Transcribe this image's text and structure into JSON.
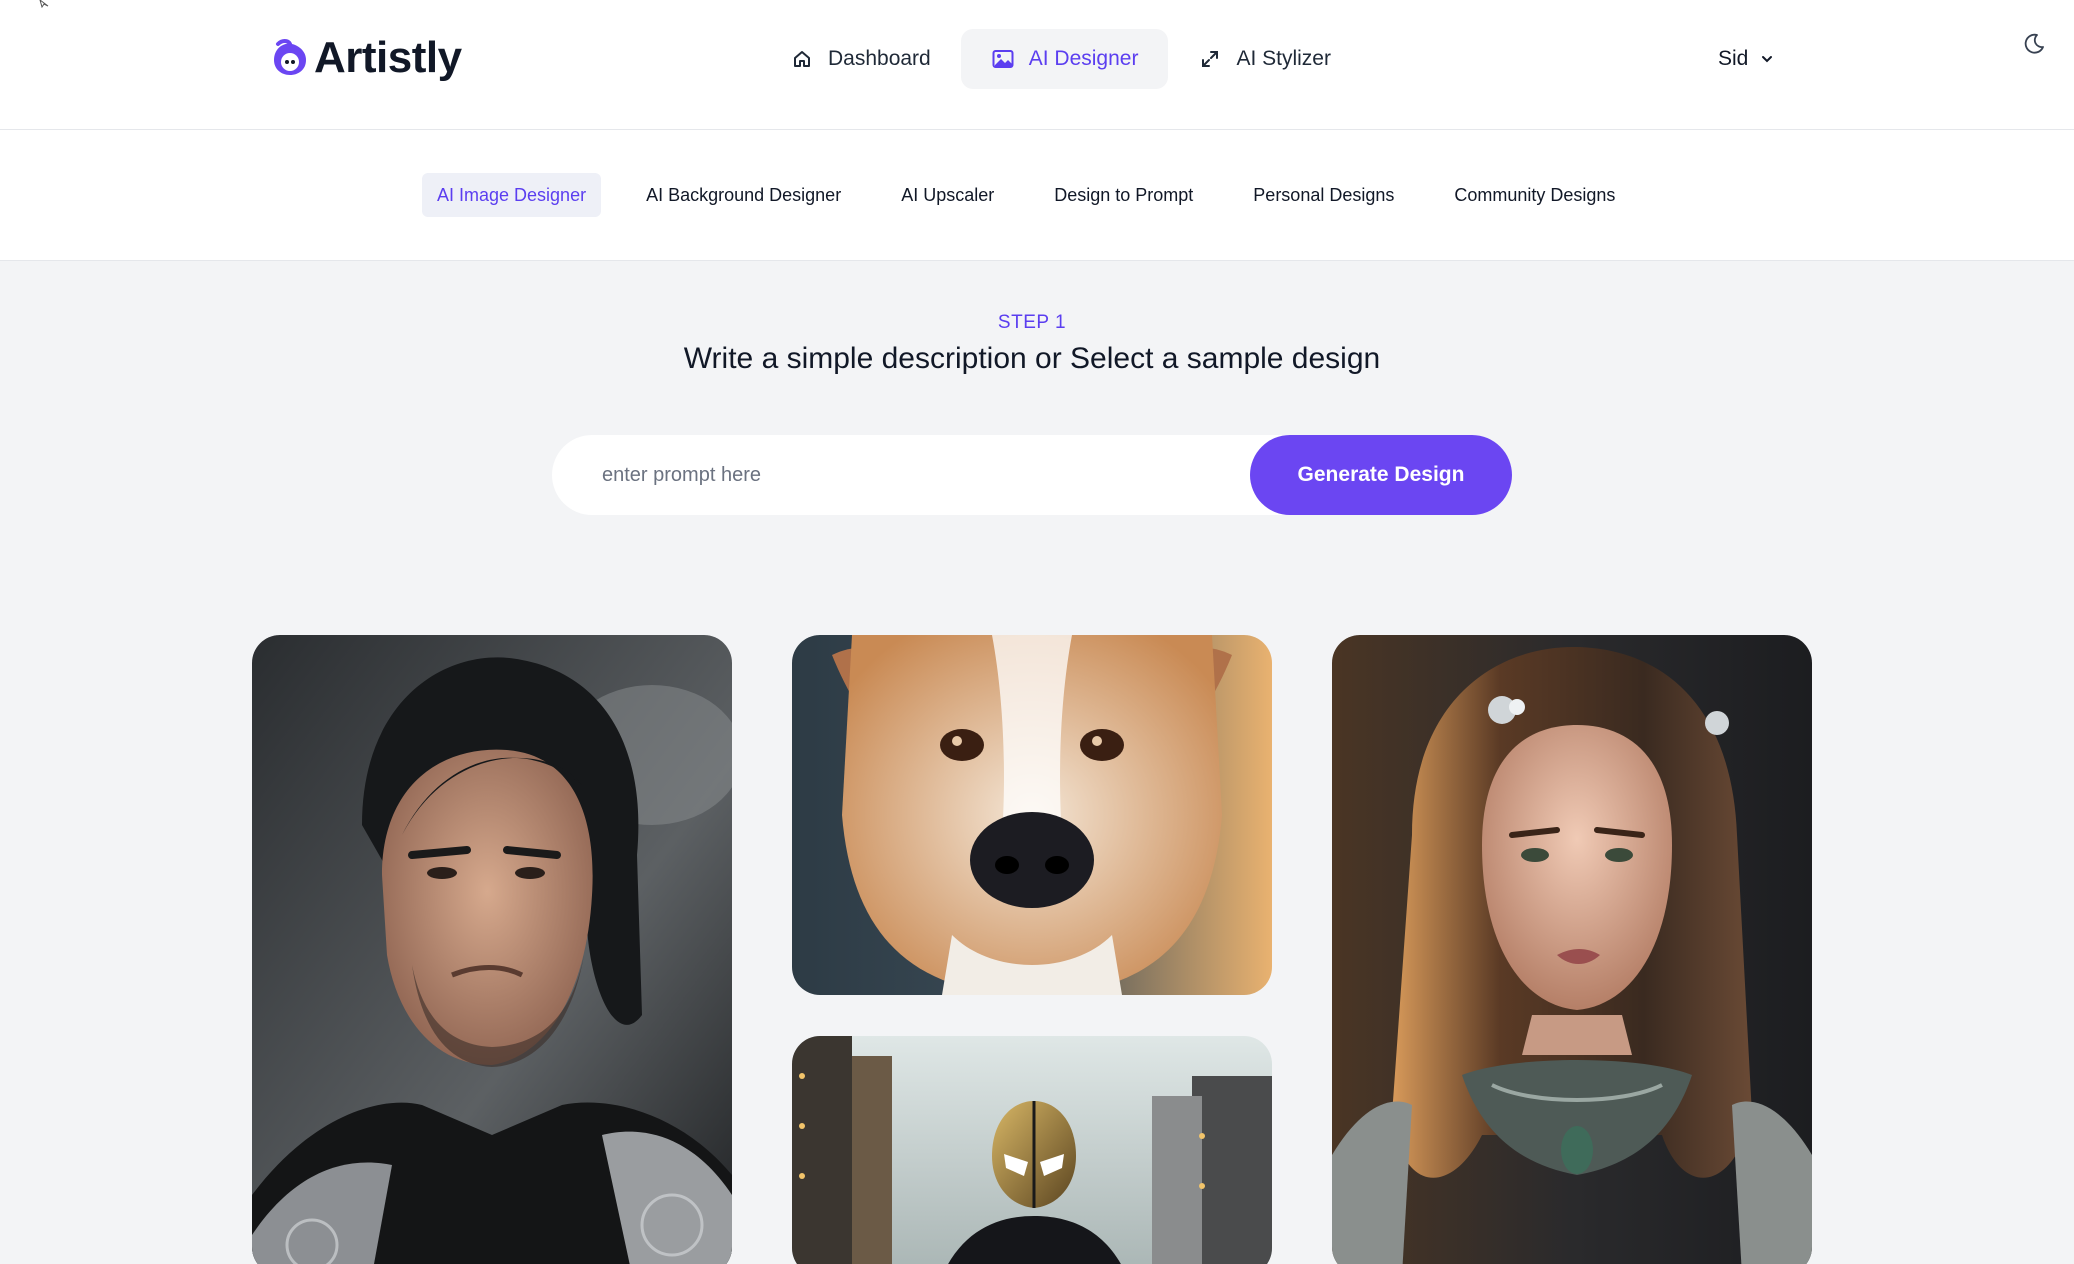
{
  "brand": {
    "name": "Artistly",
    "accent": "#6b46f2"
  },
  "main_nav": [
    {
      "label": "Dashboard",
      "icon": "home-icon"
    },
    {
      "label": "AI Designer",
      "icon": "image-icon",
      "active": true
    },
    {
      "label": "AI Stylizer",
      "icon": "expand-icon"
    }
  ],
  "user": {
    "name": "Sid"
  },
  "sub_nav": [
    {
      "label": "AI Image Designer",
      "active": true
    },
    {
      "label": "AI Background Designer"
    },
    {
      "label": "AI Upscaler"
    },
    {
      "label": "Design to Prompt"
    },
    {
      "label": "Personal Designs"
    },
    {
      "label": "Community Designs"
    }
  ],
  "step": {
    "label": "STEP 1",
    "title": "Write a simple description or Select a sample design"
  },
  "prompt": {
    "placeholder": "enter prompt here",
    "value": "",
    "button_label": "Generate Design"
  },
  "gallery": [
    {
      "subject": "man-portrait"
    },
    {
      "subject": "dog-portrait"
    },
    {
      "subject": "woman-portrait"
    },
    {
      "subject": "masked-hero"
    }
  ]
}
